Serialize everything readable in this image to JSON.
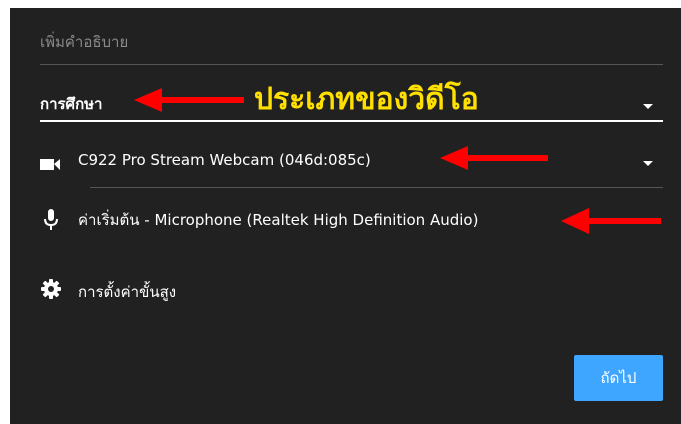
{
  "form": {
    "description_placeholder": "เพิ่มคำอธิบาย",
    "category_value": "การศึกษา",
    "camera_value": "C922 Pro Stream Webcam (046d:085c)",
    "microphone_value": "ค่าเริ่มต้น - Microphone (Realtek High Definition Audio)",
    "advanced_settings_label": "การตั้งค่าขั้นสูง",
    "next_button_label": "ถัดไป"
  },
  "annotation": {
    "text": "ประเภทของวิดีโอ",
    "arrow_color": "#ff0000",
    "text_color": "#ffe000"
  },
  "icons": {
    "camera": "video-camera-icon",
    "microphone": "microphone-icon",
    "settings": "gear-icon"
  },
  "colors": {
    "background": "#212121",
    "accent": "#3ea6ff",
    "text": "#ffffff",
    "muted": "#8a8a8a"
  }
}
